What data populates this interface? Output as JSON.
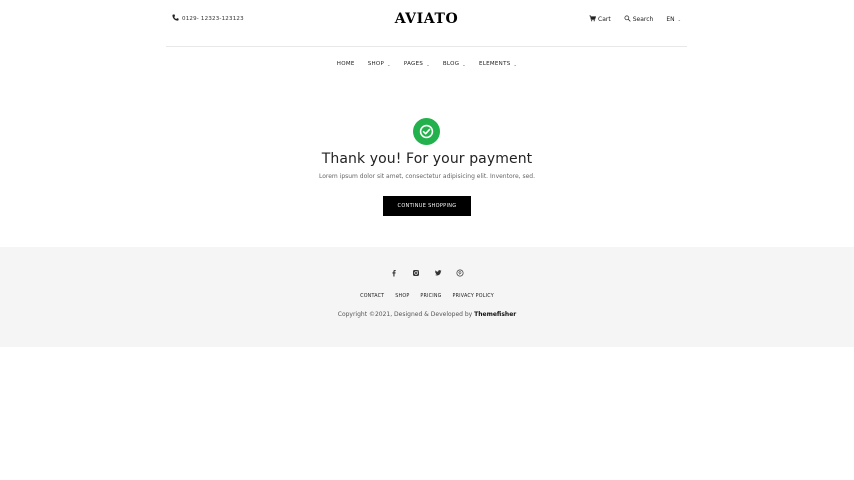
{
  "header": {
    "phone": "0129- 12323-123123",
    "logo": "AVIATO",
    "cart_label": "Cart",
    "search_label": "Search",
    "language": "EN"
  },
  "nav": {
    "items": [
      {
        "label": "HOME",
        "dropdown": false
      },
      {
        "label": "SHOP",
        "dropdown": true
      },
      {
        "label": "PAGES",
        "dropdown": true
      },
      {
        "label": "BLOG",
        "dropdown": true
      },
      {
        "label": "ELEMENTS",
        "dropdown": true
      }
    ]
  },
  "main": {
    "headline": "Thank you! For your payment",
    "subtext": "Lorem ipsum dolor sit amet, consectetur adipisicing elit. Inventore, sed.",
    "cta_label": "CONTINUE SHOPPING",
    "success_color": "#22b14c"
  },
  "footer": {
    "socials": [
      "facebook-icon",
      "instagram-icon",
      "twitter-icon",
      "pinterest-icon"
    ],
    "links": [
      "CONTACT",
      "SHOP",
      "PRICING",
      "PRIVACY POLICY"
    ],
    "copyright_prefix": "Copyright ©2021, Designed & Developed by ",
    "copyright_brand": "Themefisher"
  }
}
